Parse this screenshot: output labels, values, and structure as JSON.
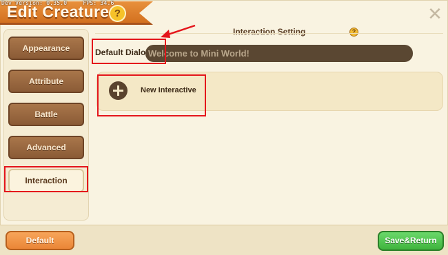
{
  "debug": {
    "dev_version": "Dev Version: 0.35.0",
    "fps": "FPS: 34.6"
  },
  "header": {
    "title": "Edit Creature",
    "help_icon": "question-mark-icon",
    "help_label": "?",
    "close_icon": "close-icon",
    "close_label": "✕"
  },
  "sidebar": {
    "items": [
      {
        "label": "Appearance",
        "active": false
      },
      {
        "label": "Attribute",
        "active": false
      },
      {
        "label": "Battle",
        "active": false
      },
      {
        "label": "Advanced",
        "active": false
      },
      {
        "label": "Interaction",
        "active": true
      }
    ]
  },
  "main": {
    "section_title": "Interaction Setting",
    "section_help_label": "?",
    "default_dialog_label": "Default Dialogue",
    "default_dialog_value": "Welcome to Mini World!",
    "new_interactive_label": "New Interactive",
    "new_interactive_icon": "plus-circle-icon"
  },
  "footer": {
    "default_label": "Default",
    "save_label": "Save&Return"
  },
  "colors": {
    "accent_orange": "#e8913c",
    "sidebar_button": "#9a6a40",
    "save_green": "#4cc24a",
    "annotation_red": "#e4151b"
  }
}
